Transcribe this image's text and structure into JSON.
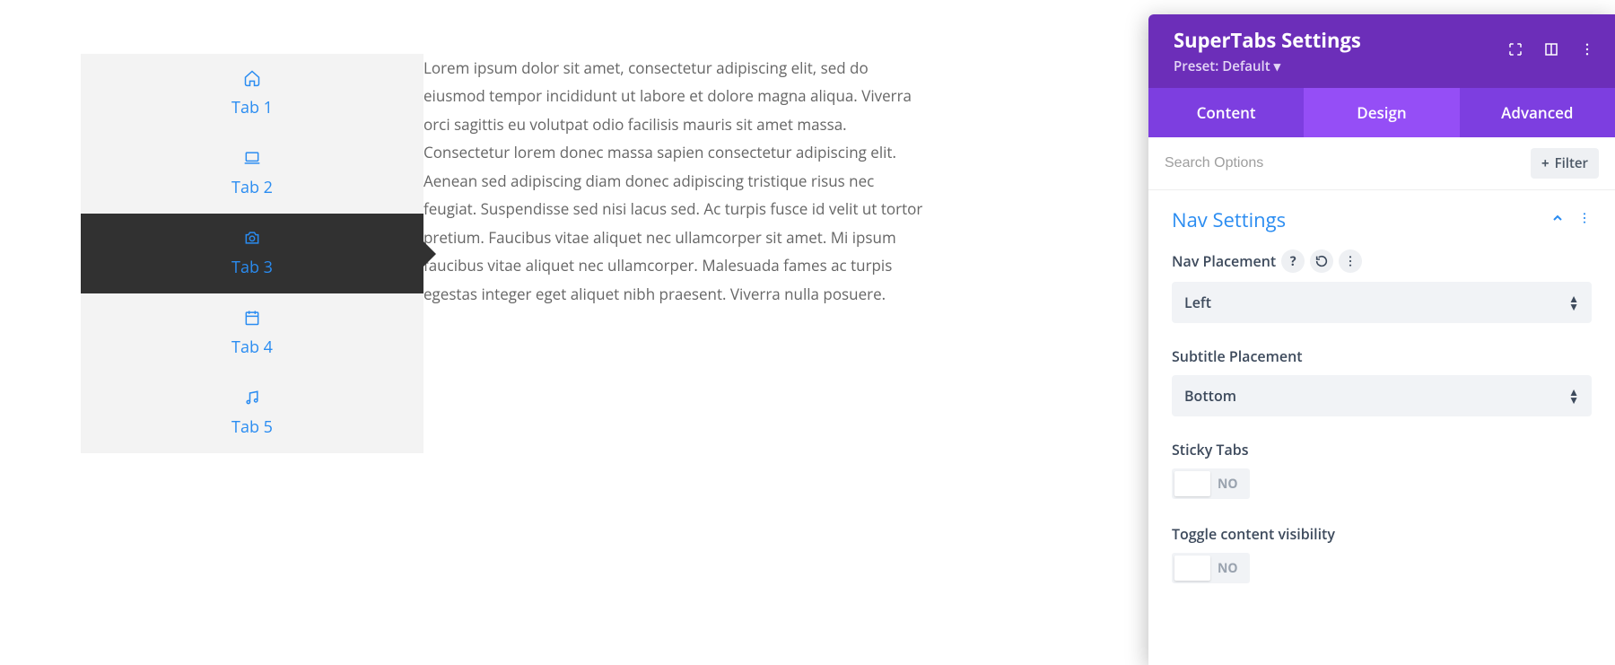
{
  "tabs": {
    "items": [
      {
        "label": "Tab 1",
        "icon": "home"
      },
      {
        "label": "Tab 2",
        "icon": "laptop"
      },
      {
        "label": "Tab 3",
        "icon": "camera"
      },
      {
        "label": "Tab 4",
        "icon": "calendar"
      },
      {
        "label": "Tab 5",
        "icon": "music"
      }
    ],
    "active_index": 2,
    "content": "Lorem ipsum dolor sit amet, consectetur adipiscing elit, sed do eiusmod tempor incididunt ut labore et dolore magna aliqua. Viverra orci sagittis eu volutpat odio facilisis mauris sit amet massa. Consectetur lorem donec massa sapien consectetur adipiscing elit. Aenean sed adipiscing diam donec adipiscing tristique risus nec feugiat. Suspendisse sed nisi lacus sed. Ac turpis fusce id velit ut tortor pretium. Faucibus vitae aliquet nec ullamcorper sit amet. Mi ipsum faucibus vitae aliquet nec ullamcorper. Malesuada fames ac turpis egestas integer eget aliquet nibh praesent. Viverra nulla posuere."
  },
  "panel": {
    "title": "SuperTabs Settings",
    "preset_label": "Preset: Default",
    "tabs": [
      {
        "label": "Content"
      },
      {
        "label": "Design"
      },
      {
        "label": "Advanced"
      }
    ],
    "active_tab": 1,
    "search_placeholder": "Search Options",
    "filter_label": "Filter",
    "section_nav": {
      "title": "Nav Settings",
      "nav_placement": {
        "label": "Nav Placement",
        "value": "Left"
      },
      "subtitle_placement": {
        "label": "Subtitle Placement",
        "value": "Bottom"
      },
      "sticky_tabs": {
        "label": "Sticky Tabs",
        "value": "NO"
      },
      "toggle_content": {
        "label": "Toggle content visibility",
        "value": "NO"
      }
    }
  }
}
